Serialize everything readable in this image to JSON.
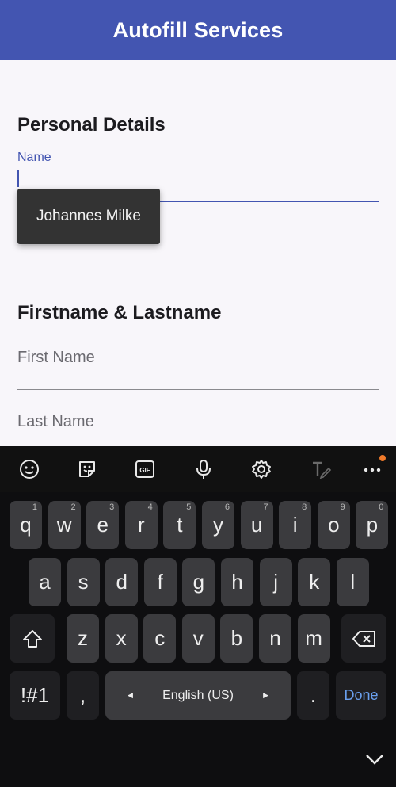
{
  "app": {
    "title": "Autofill Services"
  },
  "personal_section": {
    "title": "Personal Details",
    "name_label": "Name",
    "suggestion": "Johannes Milke"
  },
  "name_section": {
    "title": "Firstname & Lastname",
    "first_name_placeholder": "First Name",
    "last_name_placeholder": "Last Name"
  },
  "colors": {
    "primary": "#4355b1",
    "keyboard_bg": "#0e0e10",
    "key_bg": "#3b3b3e",
    "done": "#6aa0ef",
    "badge": "#f07a2a"
  },
  "keyboard": {
    "toolbar_icons": [
      "emoji-icon",
      "sticker-icon",
      "gif-icon",
      "microphone-icon",
      "settings-icon",
      "handwriting-icon",
      "more-icon"
    ],
    "gif_label": "GIF",
    "row1": [
      {
        "k": "q",
        "h": "1"
      },
      {
        "k": "w",
        "h": "2"
      },
      {
        "k": "e",
        "h": "3"
      },
      {
        "k": "r",
        "h": "4"
      },
      {
        "k": "t",
        "h": "5"
      },
      {
        "k": "y",
        "h": "6"
      },
      {
        "k": "u",
        "h": "7"
      },
      {
        "k": "i",
        "h": "8"
      },
      {
        "k": "o",
        "h": "9"
      },
      {
        "k": "p",
        "h": "0"
      }
    ],
    "row2": [
      "a",
      "s",
      "d",
      "f",
      "g",
      "h",
      "j",
      "k",
      "l"
    ],
    "row3": [
      "z",
      "x",
      "c",
      "v",
      "b",
      "n",
      "m"
    ],
    "symbols_label": "!#1",
    "comma": ",",
    "space_label": "English (US)",
    "period": ".",
    "done_label": "Done"
  }
}
